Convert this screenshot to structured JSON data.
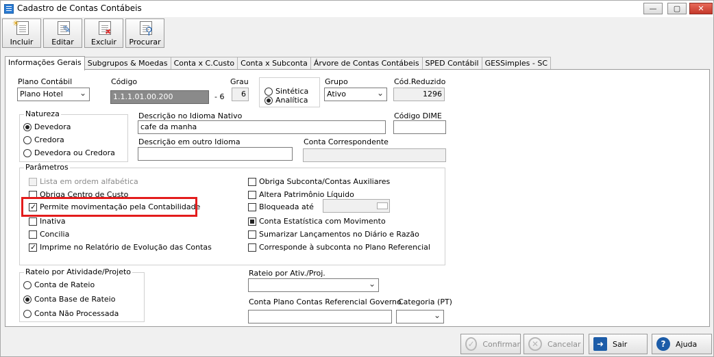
{
  "window": {
    "title": "Cadastro de Contas Contábeis",
    "min": "—",
    "max": "▢",
    "close": "✕"
  },
  "toolbar": [
    {
      "label": "Incluir",
      "icon": "add-document-icon"
    },
    {
      "label": "Editar",
      "icon": "edit-document-icon"
    },
    {
      "label": "Excluir",
      "icon": "delete-document-icon"
    },
    {
      "label": "Procurar",
      "icon": "search-document-icon"
    }
  ],
  "tabs": [
    "Informações Gerais",
    "Subgrupos & Moedas",
    "Conta x C.Custo",
    "Conta x Subconta",
    "Árvore de Contas Contábeis",
    "SPED Contábil",
    "GESSimples - SC"
  ],
  "form": {
    "plano": {
      "label": "Plano Contábil",
      "value": "Plano Hotel"
    },
    "codigo": {
      "label": "Código",
      "value": "1.1.1.01.00.200",
      "suffix": "- 6"
    },
    "grau": {
      "label": "Grau",
      "value": "6"
    },
    "tipo": {
      "options": [
        "Sintética",
        "Analítica"
      ],
      "selected": "Analítica"
    },
    "grupo": {
      "label": "Grupo",
      "value": "Ativo"
    },
    "cod_reduzido": {
      "label": "Cód.Reduzido",
      "value": "1296"
    },
    "natureza": {
      "title": "Natureza",
      "options": [
        "Devedora",
        "Credora",
        "Devedora ou Credora"
      ],
      "selected": "Devedora"
    },
    "desc_nativo": {
      "label": "Descrição no Idioma Nativo",
      "value": "cafe da manha"
    },
    "codigo_dime": {
      "label": "Código DIME",
      "value": ""
    },
    "desc_outro": {
      "label": "Descrição em outro Idioma",
      "value": ""
    },
    "conta_corresp": {
      "label": "Conta Correspondente",
      "value": ""
    },
    "parametros": {
      "title": "Parâmetros",
      "left": [
        {
          "label": "Lista em ordem alfabética",
          "checked": false,
          "disabled": true
        },
        {
          "label": "Obriga Centro de Custo",
          "checked": false,
          "disabled": false
        },
        {
          "label": "Permite movimentação pela Contabilidade",
          "checked": true,
          "disabled": false
        },
        {
          "label": "Inativa",
          "checked": false,
          "disabled": false
        },
        {
          "label": "Concilia",
          "checked": false,
          "disabled": false
        },
        {
          "label": "Imprime no Relatório de Evolução das Contas",
          "checked": true,
          "disabled": false
        }
      ],
      "right": [
        {
          "label": "Obriga Subconta/Contas Auxiliares",
          "checked": false
        },
        {
          "label": "Altera Patrimônio Líquido",
          "checked": false
        },
        {
          "label": "Bloqueada até",
          "checked": false
        },
        {
          "label": "Conta Estatística com Movimento",
          "checked": "indeterminate"
        },
        {
          "label": "Sumarizar Lançamentos no Diário e Razão",
          "checked": false
        },
        {
          "label": "Corresponde à subconta no Plano Referencial",
          "checked": false
        }
      ]
    },
    "rateio": {
      "title": "Rateio por Atividade/Projeto",
      "options": [
        "Conta de Rateio",
        "Conta Base de Rateio",
        "Conta Não Processada"
      ],
      "selected": "Conta Base de Rateio"
    },
    "rateio_ativ": {
      "label": "Rateio por Ativ./Proj.",
      "value": ""
    },
    "conta_ref_gov": {
      "label": "Conta Plano Contas Referencial Governo",
      "value": ""
    },
    "categoria": {
      "label": "Categoria (PT)",
      "value": ""
    }
  },
  "buttons": {
    "confirmar": "Confirmar",
    "cancelar": "Cancelar",
    "sair": "Sair",
    "ajuda": "Ajuda"
  },
  "colors": {
    "highlight": "#e31c1c",
    "accent": "#1c5ca8"
  }
}
